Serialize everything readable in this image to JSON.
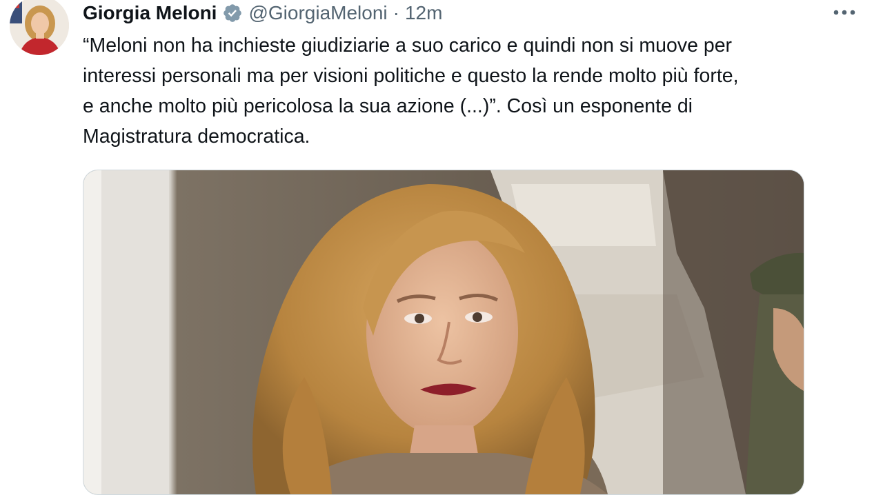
{
  "tweet": {
    "author": {
      "display_name": "Giorgia Meloni",
      "handle": "@GiorgiaMeloni",
      "verified": true,
      "avatar_icon": "profile-photo"
    },
    "separator": "·",
    "time": "12m",
    "more_icon": "more-horizontal-icon",
    "text_lines": [
      "“Meloni non ha inchieste giudiziarie a suo carico e quindi non si muove per",
      "interessi personali ma per visioni politiche e questo la rende molto più forte,",
      "e anche molto più pericolosa la sua azione (...)”. Così un esponente di",
      "Magistratura democratica."
    ],
    "media": {
      "kind": "photo"
    }
  },
  "colors": {
    "text_primary": "#0f1419",
    "text_secondary": "#536471",
    "verified_badge": "#829aab",
    "media_border": "#cfd9de"
  }
}
